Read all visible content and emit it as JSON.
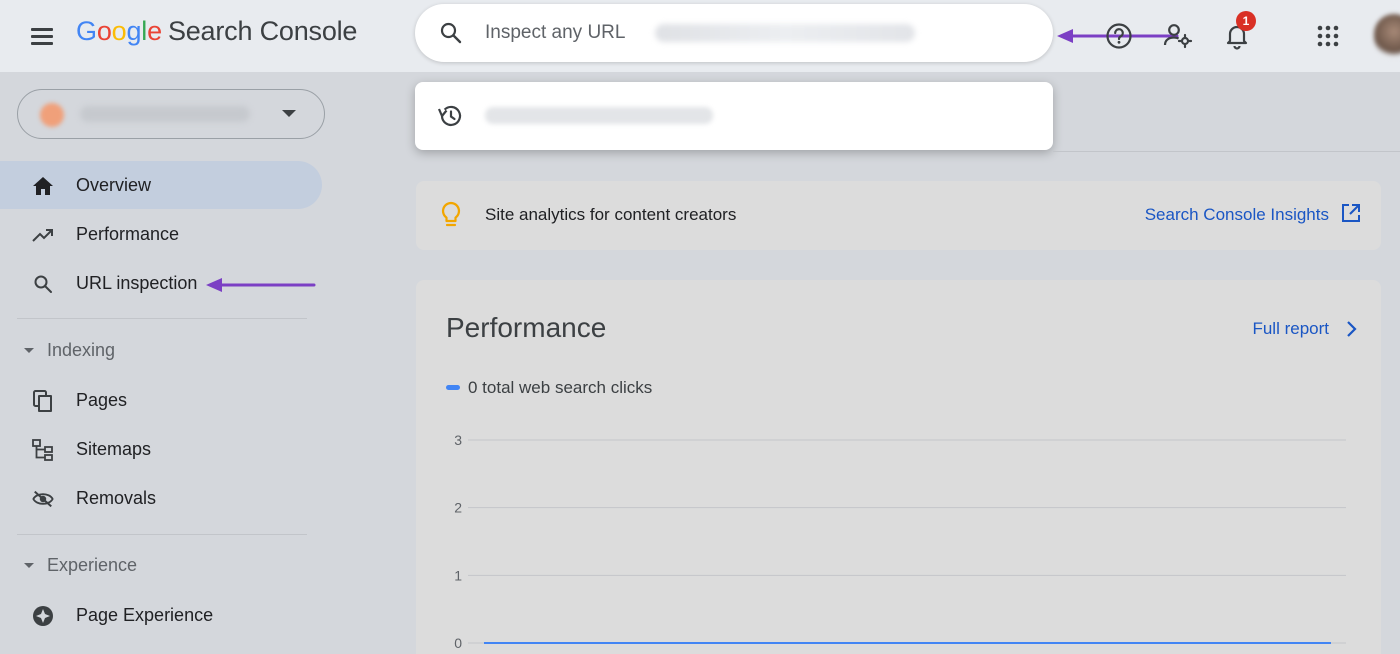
{
  "header": {
    "logo_google": [
      "G",
      "o",
      "o",
      "g",
      "l",
      "e"
    ],
    "logo_product": "Search Console",
    "search_placeholder": "Inspect any URL",
    "notification_count": "1"
  },
  "search_dropdown": {
    "items": [
      {
        "icon": "history-icon",
        "text_blurred": true
      }
    ]
  },
  "sidebar": {
    "property_selector": {
      "value_blurred": true
    },
    "items": [
      {
        "label": "Overview",
        "icon": "home-icon",
        "active": true
      },
      {
        "label": "Performance",
        "icon": "trending-up-icon"
      },
      {
        "label": "URL inspection",
        "icon": "search-icon"
      }
    ],
    "sections": [
      {
        "label": "Indexing",
        "items": [
          {
            "label": "Pages",
            "icon": "pages-icon"
          },
          {
            "label": "Sitemaps",
            "icon": "sitemap-icon"
          },
          {
            "label": "Removals",
            "icon": "removals-icon"
          }
        ]
      },
      {
        "label": "Experience",
        "items": [
          {
            "label": "Page Experience",
            "icon": "page-experience-icon"
          }
        ]
      }
    ]
  },
  "insights": {
    "text": "Site analytics for content creators",
    "link": "Search Console Insights"
  },
  "performance": {
    "title": "Performance",
    "full_report": "Full report",
    "legend": "0 total web search clicks"
  },
  "chart_data": {
    "type": "line",
    "series": [
      {
        "name": "0 total web search clicks",
        "values": [
          0,
          0
        ]
      }
    ],
    "ylim": [
      0,
      3
    ],
    "yticks": [
      "3",
      "2",
      "1",
      "0"
    ],
    "grid": true,
    "colors": {
      "line": "#4285f4"
    }
  },
  "colors": {
    "accent": "#1a56c4",
    "active_nav": "#c3cede",
    "annotation_arrow": "#7b3fc4",
    "badge": "#d93025"
  }
}
